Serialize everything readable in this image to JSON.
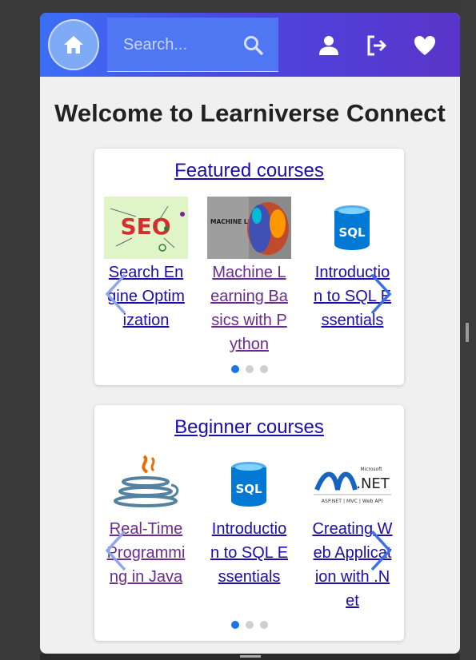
{
  "header": {
    "search_placeholder": "Search...",
    "icons": [
      "home-icon",
      "search-icon",
      "user-icon",
      "logout-icon",
      "heart-icon"
    ],
    "gradient": [
      "#3c6ff5",
      "#5a34c9"
    ]
  },
  "page": {
    "title": "Welcome to Learniverse Connect"
  },
  "sections": [
    {
      "title": "Featured courses",
      "items": [
        {
          "label": "Search Engine Optimization",
          "thumb": "seo-thumbnail"
        },
        {
          "label": "Machine Learning Basics with Python",
          "thumb": "machine-learning-thumbnail"
        },
        {
          "label": "Introduction to SQL Essentials",
          "thumb": "sql-thumbnail"
        }
      ],
      "dots": 3,
      "active_dot": 1
    },
    {
      "title": "Beginner courses",
      "items": [
        {
          "label": "Real-Time Programming in Java",
          "thumb": "java-thumbnail"
        },
        {
          "label": "Introduction to SQL Essentials",
          "thumb": "sql-thumbnail"
        },
        {
          "label": "Creating Web Application with .Net",
          "thumb": "dotnet-thumbnail"
        }
      ],
      "dots": 3,
      "active_dot": 1
    }
  ],
  "logos": {
    "seo": "SEO",
    "machine_learning": "MACHINE LEARNING",
    "sql": "SQL",
    "dotnet_brand": "Microsoft",
    "dotnet_name": ".NET",
    "dotnet_tagline": "ASP.NET | MVC | Web API"
  }
}
